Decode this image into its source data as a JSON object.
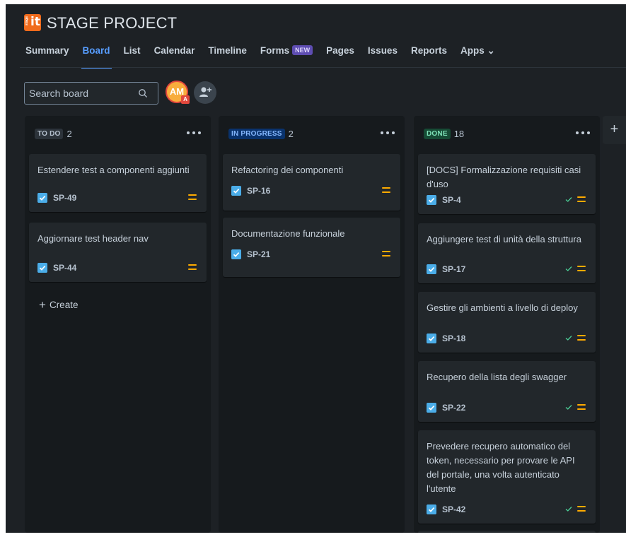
{
  "project": {
    "logo_stage": "stage",
    "logo_it": "it",
    "title": "STAGE PROJECT"
  },
  "tabs": [
    {
      "label": "Summary"
    },
    {
      "label": "Board"
    },
    {
      "label": "List"
    },
    {
      "label": "Calendar"
    },
    {
      "label": "Timeline"
    },
    {
      "label": "Forms",
      "badge": "NEW"
    },
    {
      "label": "Pages"
    },
    {
      "label": "Issues"
    },
    {
      "label": "Reports"
    },
    {
      "label": "Apps ⌄"
    }
  ],
  "active_tab": "Board",
  "toolbar": {
    "search_placeholder": "Search board",
    "avatar_initials": "AM",
    "avatar_badge": "A",
    "add_people_icon": "add-person-icon"
  },
  "columns": [
    {
      "status": "TO DO",
      "count": "2",
      "cards": [
        {
          "title": "Estendere test a componenti aggiunti",
          "key": "SP-49",
          "done": false
        },
        {
          "title": "Aggiornare test header nav",
          "key": "SP-44",
          "done": false
        }
      ],
      "create_label": "Create"
    },
    {
      "status": "IN PROGRESS",
      "count": "2",
      "cards": [
        {
          "title": "Refactoring dei componenti",
          "key": "SP-16",
          "done": false
        },
        {
          "title": "Documentazione funzionale",
          "key": "SP-21",
          "done": false
        }
      ]
    },
    {
      "status": "DONE",
      "count": "18",
      "cards": [
        {
          "title": "[DOCS] Formalizzazione requisiti casi d'uso",
          "key": "SP-4",
          "done": true
        },
        {
          "title": "Aggiungere test di unità della struttura",
          "key": "SP-17",
          "done": true
        },
        {
          "title": "Gestire gli ambienti a livello di deploy",
          "key": "SP-18",
          "done": true
        },
        {
          "title": "Recupero della lista degli swagger",
          "key": "SP-22",
          "done": true
        },
        {
          "title": "Prevedere recupero automatico del token, necessario per provare le API del portale, una volta autenticato l'utente",
          "key": "SP-42",
          "done": true
        }
      ]
    }
  ],
  "add_column_label": "+",
  "colors": {
    "background": "#1d2125",
    "column": "#161a1d",
    "card": "#22272b",
    "accent": "#579dff",
    "priority_medium": "#ffab00",
    "done_check": "#4bce97",
    "issue_type_task": "#4bade8"
  }
}
